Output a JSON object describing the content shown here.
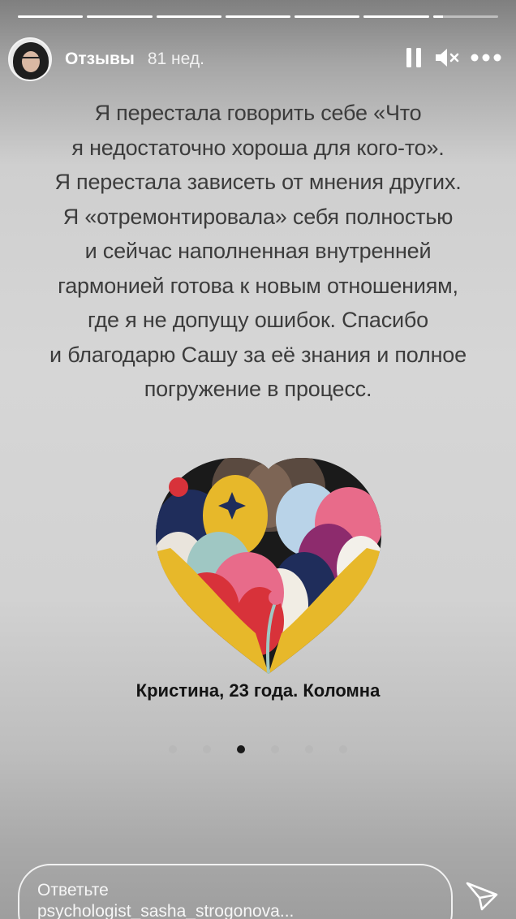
{
  "progress": {
    "total_segments": 7,
    "current_index": 6,
    "current_fraction": 0.15
  },
  "header": {
    "account_name": "Отзывы",
    "time_ago": "81 нед."
  },
  "icons": {
    "pause": "pause-icon",
    "mute": "speaker-muted-icon",
    "more": "more-dots-icon",
    "send": "send-icon"
  },
  "quote": {
    "lines": [
      "Я перестала говорить себе «Что",
      "я недостаточно хороша для кого-то».",
      "Я перестала зависеть от мнения других.",
      "Я «отремонтировала» себя полностью",
      "и сейчас наполненная внутренней",
      "гармонией готова к новым отношениям,",
      "где я не допущу ошибок. Спасибо",
      "и благодарю Сашу за её знания и полное",
      "погружение в процесс."
    ]
  },
  "caption": "Кристина, 23 года. Коломна",
  "carousel": {
    "count": 6,
    "active": 2
  },
  "reply": {
    "line1": "Ответьте",
    "line2": "psychologist_sasha_strogonova..."
  },
  "colors": {
    "accent_yellow": "#e7b82a",
    "accent_red": "#d8323a",
    "accent_navy": "#1f2d5b",
    "accent_purple": "#8d2b6d",
    "accent_pink": "#e86b8a"
  }
}
